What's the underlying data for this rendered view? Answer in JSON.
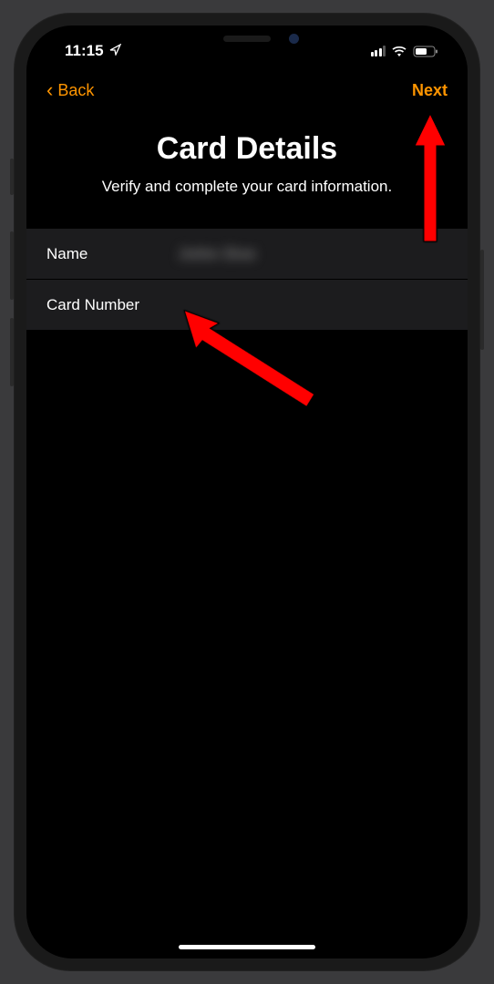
{
  "status": {
    "time": "11:15",
    "location_icon": "◤"
  },
  "nav": {
    "back_label": "Back",
    "next_label": "Next"
  },
  "header": {
    "title": "Card Details",
    "subtitle": "Verify and complete your card information."
  },
  "form": {
    "name_label": "Name",
    "name_value": "John Doe",
    "number_label": "Card Number",
    "number_value": ""
  },
  "colors": {
    "accent": "#ff9500",
    "row_bg": "#1c1c1e"
  }
}
